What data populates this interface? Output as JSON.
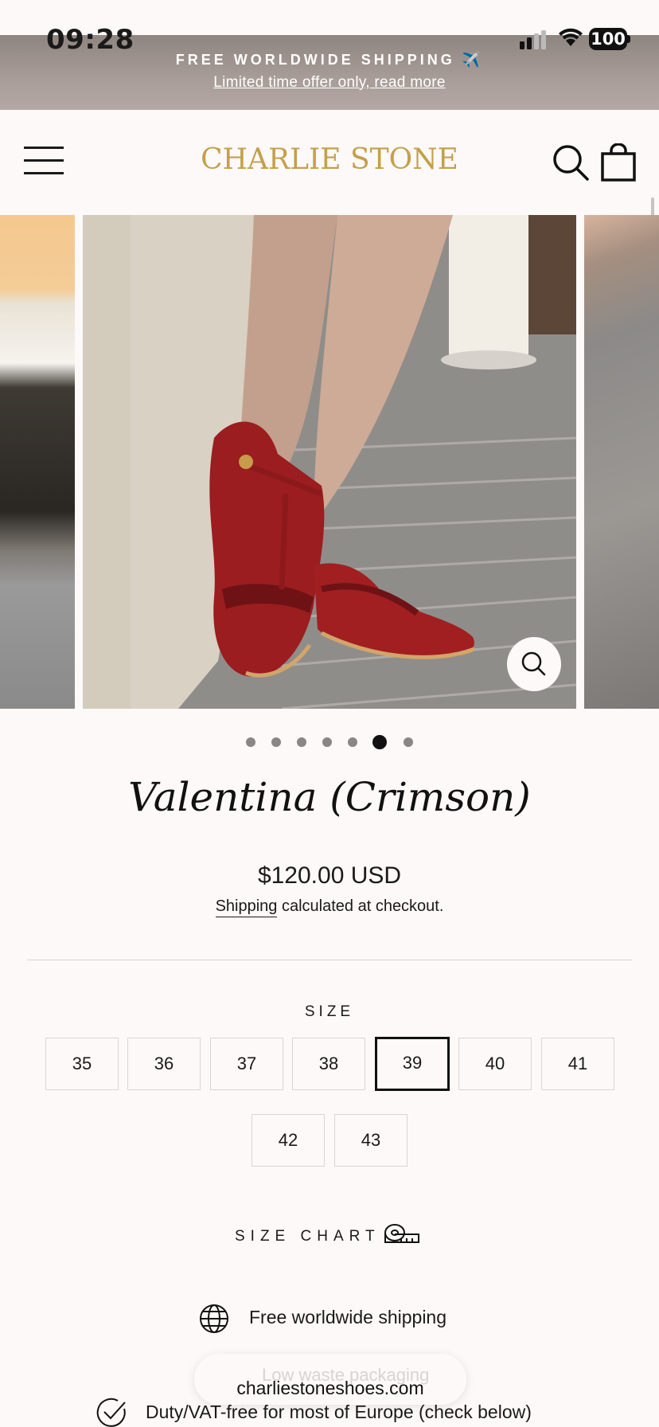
{
  "status_bar": {
    "time": "09:28",
    "battery": "100"
  },
  "announcement": {
    "title": "FREE WORLDWIDE SHIPPING ✈️",
    "link": "Limited time offer only, read more"
  },
  "header": {
    "logo": "CHARLIE STONE"
  },
  "gallery": {
    "slide_count": 7,
    "active_index": 5
  },
  "product": {
    "title": "Valentina (Crimson)",
    "price": "$120.00 USD",
    "shipping_link": "Shipping",
    "shipping_rest": " calculated at checkout."
  },
  "size": {
    "label": "SIZE",
    "options": [
      "35",
      "36",
      "37",
      "38",
      "39",
      "40",
      "41",
      "42",
      "43"
    ],
    "selected": "39"
  },
  "size_chart": {
    "label": "SIZE CHART"
  },
  "features": [
    {
      "icon": "globe-icon",
      "text": "Free worldwide shipping"
    },
    {
      "icon": "check-circle-icon",
      "text": "Duty/VAT-free for most of Europe (check below)"
    }
  ],
  "browser": {
    "url": "charliestoneshoes.com",
    "ghost_text": "Low waste packaging"
  },
  "colors": {
    "logo_gold": "#c4a04a",
    "background": "#fdf9f8",
    "announcement_bg": "#a39893"
  }
}
